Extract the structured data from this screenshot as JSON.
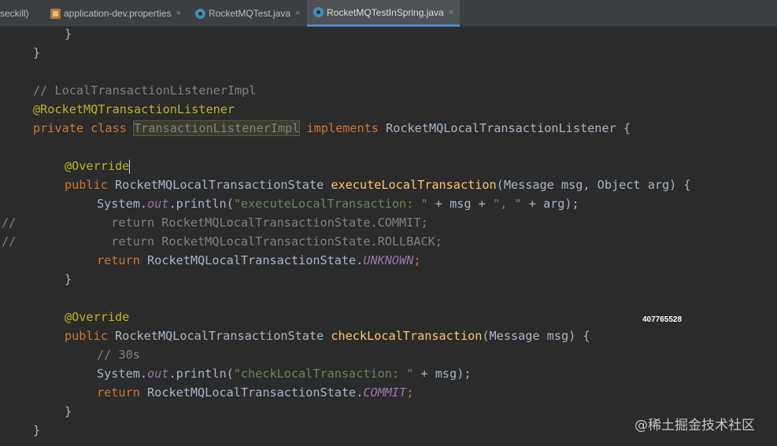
{
  "tabs": [
    {
      "label": "seckill)",
      "icon": "none",
      "active": false
    },
    {
      "label": "application-dev.properties",
      "icon": "properties-file-icon",
      "active": false
    },
    {
      "label": "RocketMQTest.java",
      "icon": "java-class-icon",
      "active": false
    },
    {
      "label": "RocketMQTestInSpring.java",
      "icon": "java-class-icon",
      "active": true
    }
  ],
  "close_glyph": "×",
  "code": {
    "l1": "}",
    "l2": "}",
    "l4_comment": "// LocalTransactionListenerImpl",
    "l5_annotation": "@RocketMQTransactionListener",
    "l6_kw": "private class",
    "l6_class": "TransactionListenerImpl",
    "l6_kw2": "implements",
    "l6_rest": "RocketMQLocalTransactionListener {",
    "l8_annotation": "@Override",
    "l9_kw": "public",
    "l9_type": "RocketMQLocalTransactionState",
    "l9_method": "executeLocalTransaction",
    "l9_params": "(Message msg, Object arg) {",
    "l10_pre": "System.",
    "l10_out": "out",
    "l10_mid": ".println(",
    "l10_str": "\"executeLocalTransaction: \"",
    "l10_str2": "\", \"",
    "l10_a": " + msg + ",
    "l10_b": " + arg);",
    "l11_comment": "  return RocketMQLocalTransactionState.COMMIT;",
    "l12_comment": "  return RocketMQLocalTransactionState.ROLLBACK;",
    "gutter_comment": "//",
    "l13_kw": "return",
    "l13_pre": "RocketMQLocalTransactionState.",
    "l13_const": "UNKNOWN",
    "l13_end": ";",
    "l14": "}",
    "l16_annotation": "@Override",
    "l17_kw": "public",
    "l17_type": "RocketMQLocalTransactionState",
    "l17_method": "checkLocalTransaction",
    "l17_params": "(Message msg) {",
    "l18_comment": "// 30s",
    "l19_pre": "System.",
    "l19_out": "out",
    "l19_mid": ".println(",
    "l19_str": "\"checkLocalTransaction: \"",
    "l19_end": " + msg);",
    "l20_kw": "return",
    "l20_pre": "RocketMQLocalTransactionState.",
    "l20_const": "COMMIT",
    "l20_end": ";",
    "l21": "}",
    "l22": "}"
  },
  "overlay_number": "407765528",
  "watermark": "@稀土掘金技术社区"
}
